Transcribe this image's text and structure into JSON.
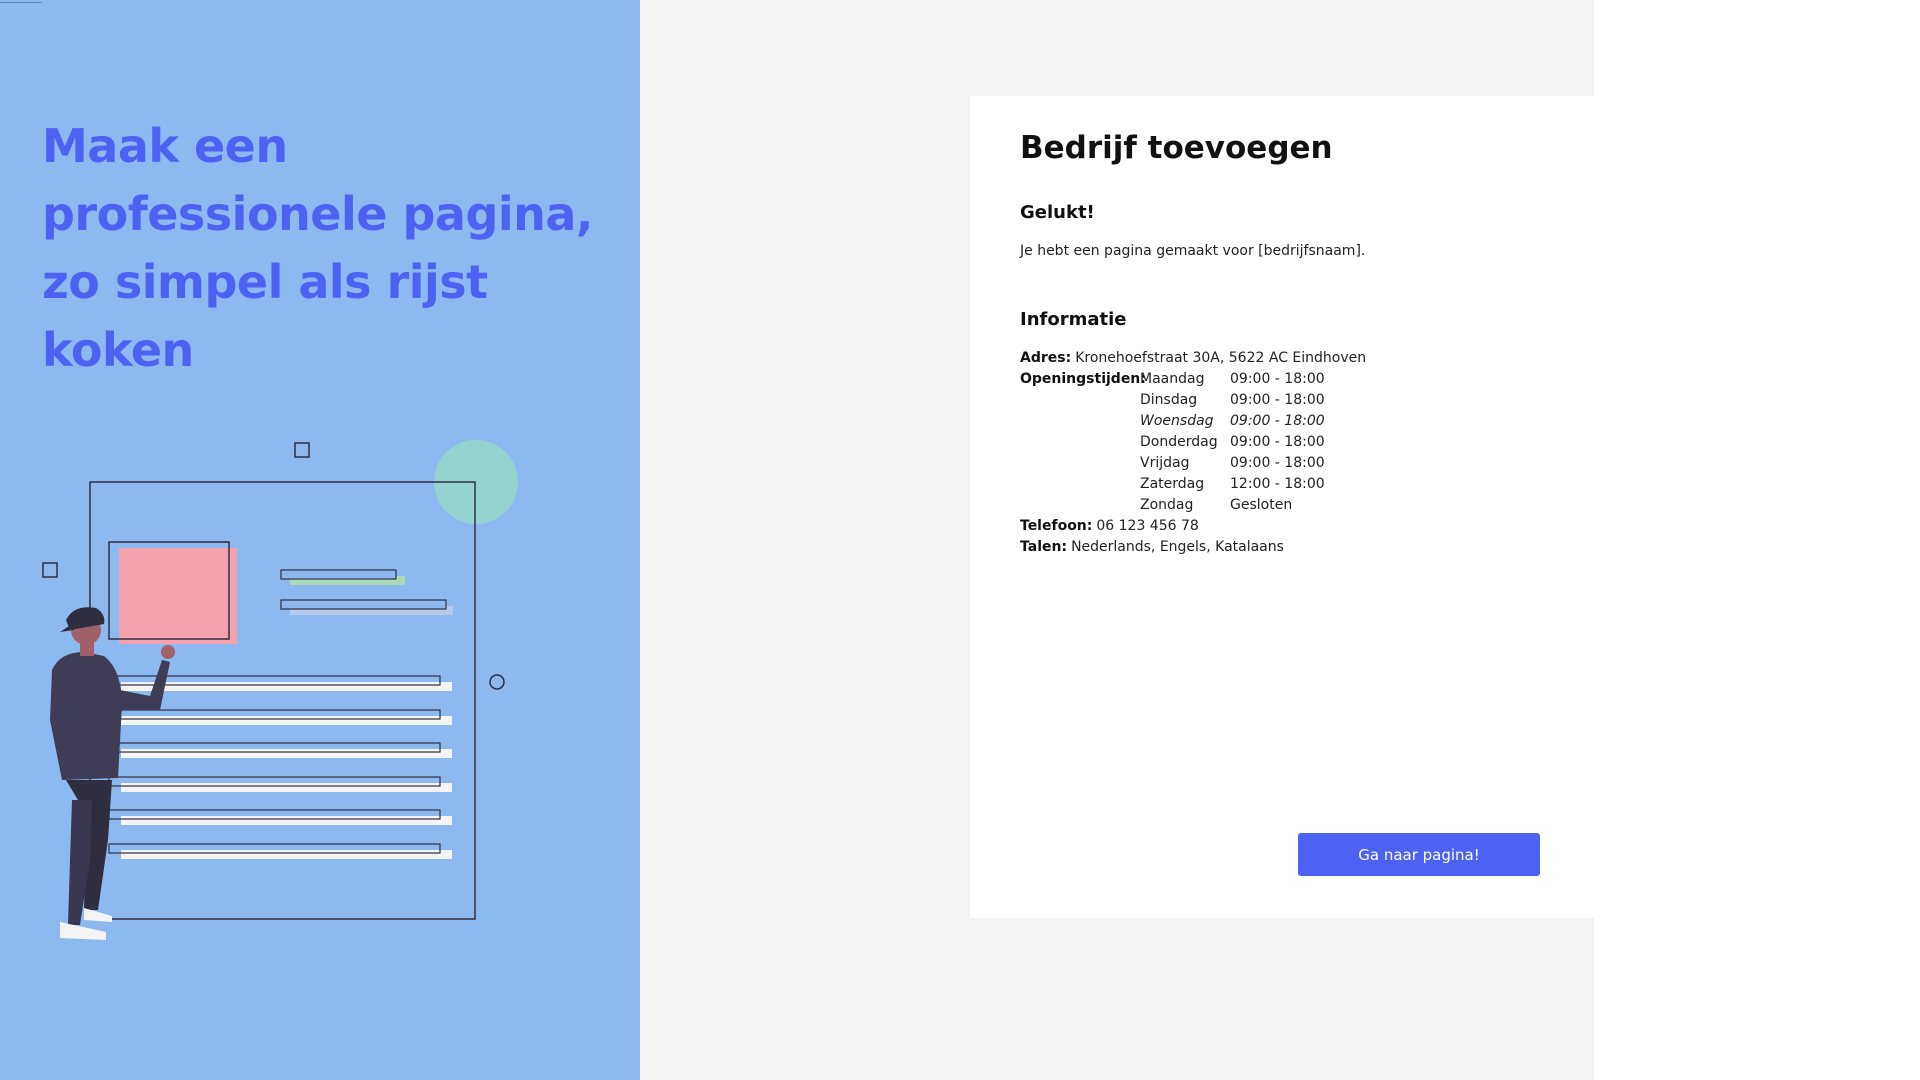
{
  "hero": {
    "title": "Maak een professionele pagina, zo simpel als rijst koken"
  },
  "card": {
    "title": "Bedrijf toevoegen",
    "success_heading": "Gelukt!",
    "success_text": "Je hebt een pagina gemaakt voor [bedrijfsnaam].",
    "info_heading": "Informatie",
    "address_label": "Adres:",
    "address_value": "Kronehoefstraat 30A, 5622 AC Eindhoven",
    "hours_label": "Openingstijden:",
    "hours": [
      {
        "day": "Maandag",
        "time": "09:00 - 18:00"
      },
      {
        "day": "Dinsdag",
        "time": "09:00 - 18:00"
      },
      {
        "day": "Woensdag",
        "time": "09:00 - 18:00"
      },
      {
        "day": "Donderdag",
        "time": "09:00 - 18:00"
      },
      {
        "day": "Vrijdag",
        "time": "09:00 - 18:00"
      },
      {
        "day": "Zaterdag",
        "time": "12:00 - 18:00"
      },
      {
        "day": "Zondag",
        "time": "Gesloten"
      }
    ],
    "phone_label": "Telefoon:",
    "phone_value": "06 123 456 78",
    "languages_label": "Talen:",
    "languages_value": "Nederlands, Engels, Katalaans",
    "button_label": "Ga naar pagina!"
  },
  "colors": {
    "left_panel": "#8cb9f0",
    "accent": "#4c62f3",
    "page_background": "#f4f4f4",
    "card": "#ffffff"
  },
  "icons": {
    "illustration": "person-building-page-illustration"
  }
}
